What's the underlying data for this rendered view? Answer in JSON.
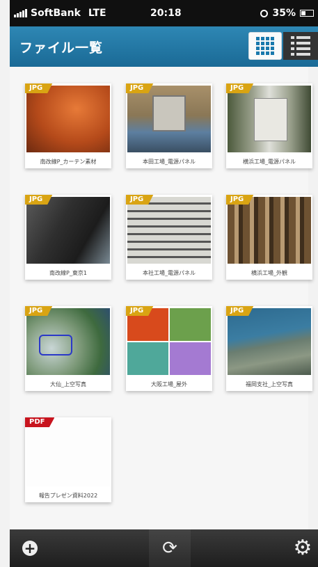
{
  "status_bar": {
    "carrier": "SoftBank",
    "network": "LTE",
    "time": "20:18",
    "battery": "35%"
  },
  "header": {
    "title": "ファイル一覧",
    "grid_icon": "grid-view-icon",
    "list_icon": "list-view-icon"
  },
  "files": [
    {
      "type": "JPG",
      "name": "南改線P_カーテン素材"
    },
    {
      "type": "JPG",
      "name": "本田工場_電源パネル"
    },
    {
      "type": "JPG",
      "name": "横浜工場_電源パネル"
    },
    {
      "type": "JPG",
      "name": "南改線P_東京1"
    },
    {
      "type": "JPG",
      "name": "本社工場_電源パネル"
    },
    {
      "type": "JPG",
      "name": "横浜工場_外観"
    },
    {
      "type": "JPG",
      "name": "大仙_上空写真"
    },
    {
      "type": "JPG",
      "name": "大阪工場_屋外"
    },
    {
      "type": "JPG",
      "name": "福岡支社_上空写真"
    },
    {
      "type": "PDF",
      "name": "報告プレゼン資料2022"
    }
  ],
  "toolbar": {
    "add_icon": "add-icon",
    "refresh_icon": "refresh-icon",
    "settings_icon": "gear-icon"
  },
  "colors": {
    "header": "#1f78a8",
    "jpg_badge": "#d9a413",
    "pdf_badge": "#c8141e"
  }
}
